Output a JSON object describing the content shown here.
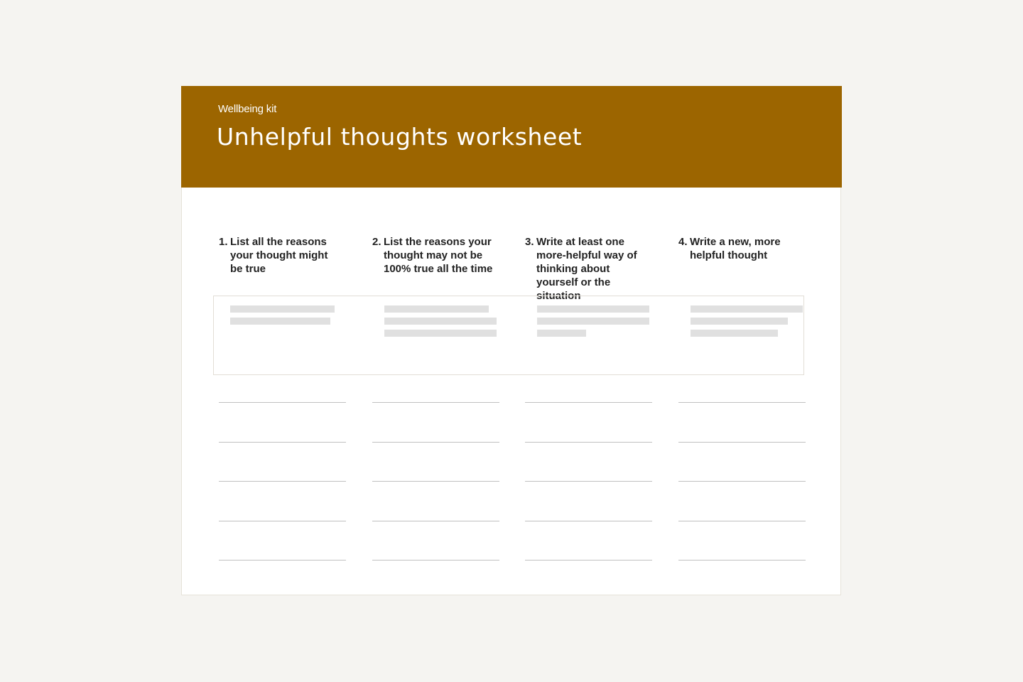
{
  "header": {
    "kicker": "Wellbeing kit",
    "title": "Unhelpful thoughts worksheet"
  },
  "colors": {
    "banner": "#9c6500",
    "page_background": "#f5f4f1",
    "sheet_background": "#ffffff",
    "placeholder_bar": "#e0e0e0",
    "rule_line": "#c0c0c0"
  },
  "columns": [
    {
      "number": "1.",
      "instruction": "List all the reasons your thought might be true"
    },
    {
      "number": "2.",
      "instruction": "List the reasons your thought may not be 100% true all the time"
    },
    {
      "number": "3.",
      "instruction": "Write at least one more-helpful way of thinking about yourself or the situation"
    },
    {
      "number": "4.",
      "instruction": "Write a new, more helpful thought"
    }
  ],
  "example_row": {
    "placeholder_lines_per_column": [
      2,
      3,
      3,
      3
    ]
  },
  "writing_lines_per_column": 5
}
